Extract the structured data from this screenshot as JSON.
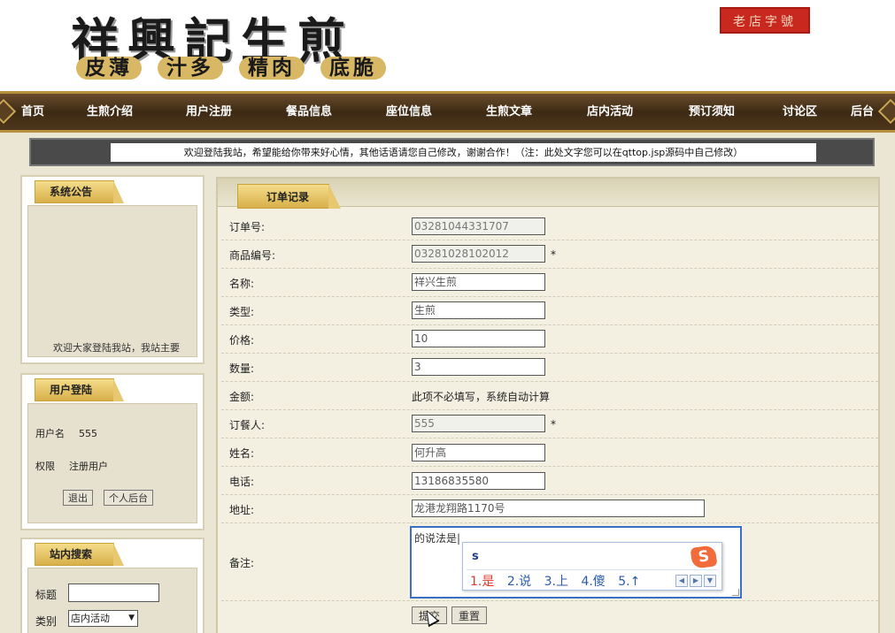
{
  "banner": {
    "title": "祥興記生煎",
    "slogans": [
      "皮薄",
      "汁多",
      "精肉",
      "底脆"
    ],
    "seal_text": "老店字號"
  },
  "nav": {
    "items": [
      "首页",
      "生煎介绍",
      "用户注册",
      "餐品信息",
      "座位信息",
      "生煎文章",
      "店内活动",
      "预订须知",
      "讨论区",
      "后台"
    ]
  },
  "welcome": {
    "text": "欢迎登陆我站，希望能给你带来好心情，其他话语请您自己修改，谢谢合作！（注：此处文字您可以在qttop.jsp源码中自己修改）"
  },
  "sidebar": {
    "notice": {
      "title": "系统公告",
      "text": "欢迎大家登陆我站，我站主要"
    },
    "login": {
      "title": "用户登陆",
      "username_label": "用户名",
      "username_value": "555",
      "role_label": "权限",
      "role_value": "注册用户",
      "logout_label": "退出",
      "personal_label": "个人后台"
    },
    "search": {
      "title": "站内搜索",
      "title_label": "标题",
      "title_value": "",
      "category_label": "类别",
      "category_value": "店内活动"
    }
  },
  "main": {
    "tab_label": "订单记录",
    "fields": {
      "order_no": {
        "label": "订单号:",
        "value": "03281044331707"
      },
      "product_no": {
        "label": "商品编号:",
        "value": "03281028102012",
        "required": "*"
      },
      "name": {
        "label": "名称:",
        "value": "祥兴生煎"
      },
      "type": {
        "label": "类型:",
        "value": "生煎"
      },
      "price": {
        "label": "价格:",
        "value": "10"
      },
      "quantity": {
        "label": "数量:",
        "value": "3"
      },
      "amount": {
        "label": "金额:",
        "value": "此项不必填写，系统自动计算"
      },
      "orderer": {
        "label": "订餐人:",
        "value": "555",
        "required": "*"
      },
      "fullname": {
        "label": "姓名:",
        "value": "何升高"
      },
      "phone": {
        "label": "电话:",
        "value": "13186835580"
      },
      "address": {
        "label": "地址:",
        "value": "龙港龙翔路1170号"
      },
      "remarks": {
        "label": "备注:",
        "value": "的说法是|"
      }
    },
    "ime": {
      "input": "s",
      "logo": "S",
      "candidates": [
        "1.是",
        "2.说",
        "3.上",
        "4.傻",
        "5.↑"
      ],
      "prev": "◀",
      "next": "▶",
      "menu": "▼"
    },
    "submit_label": "提交",
    "reset_label": "重置"
  }
}
